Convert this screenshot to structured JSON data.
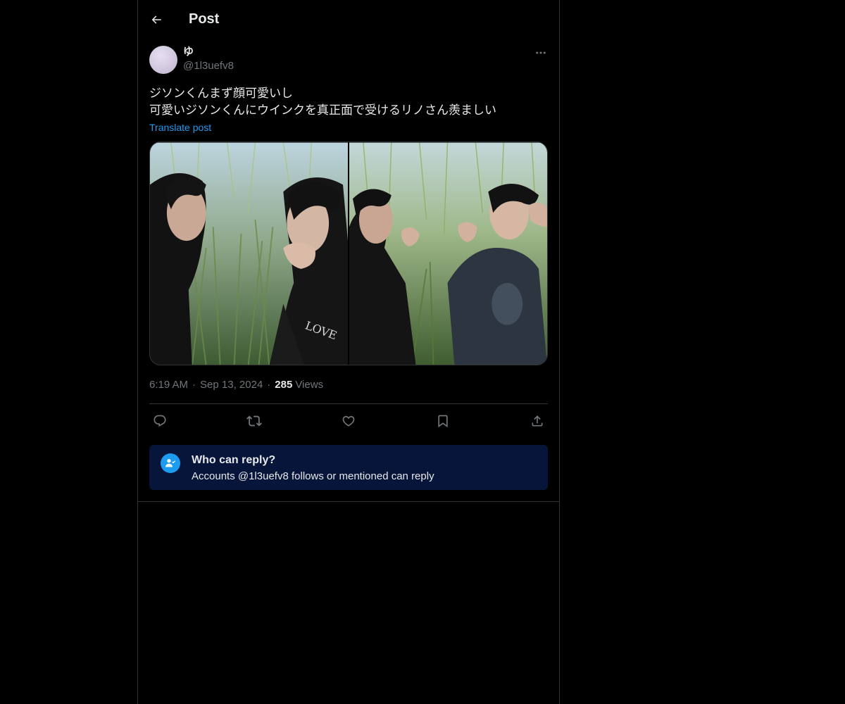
{
  "header": {
    "title": "Post"
  },
  "post": {
    "author": {
      "display_name": "ゆ",
      "handle": "@1l3uefv8"
    },
    "text_lines": [
      "ジソンくんまず顔可愛いし",
      "可愛いジソンくんにウインクを真正面で受けるリノさん羨ましい"
    ],
    "translate_label": "Translate post",
    "time": "6:19 AM",
    "date": "Sep 13, 2024",
    "views_count": "285",
    "views_label": "Views",
    "separator": "·"
  },
  "icons": {
    "back": "arrow-left-icon",
    "more": "more-horizontal-icon",
    "reply": "reply-bubble-icon",
    "repost": "repost-icon",
    "like": "heart-icon",
    "bookmark": "bookmark-icon",
    "share": "share-upload-icon",
    "who_can_reply": "person-check-icon"
  },
  "reply_restriction": {
    "title": "Who can reply?",
    "subtitle": "Accounts @1l3uefv8 follows or mentioned can reply"
  },
  "colors": {
    "background": "#000000",
    "text": "#e7e9ea",
    "muted": "#71767b",
    "accent": "#1d9bf0",
    "notice_bg": "#061539",
    "border": "#2f3336"
  }
}
